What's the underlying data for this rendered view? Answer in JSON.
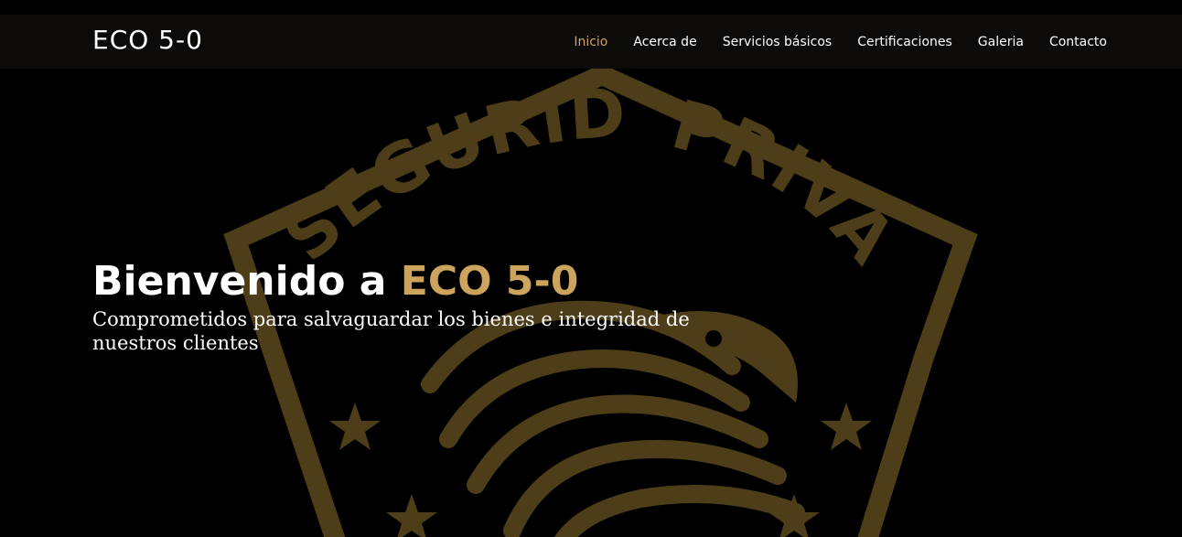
{
  "brand": {
    "name": "ECO 5-0"
  },
  "nav": {
    "items": [
      {
        "label": "Inicio",
        "active": true
      },
      {
        "label": "Acerca de"
      },
      {
        "label": "Servicios básicos"
      },
      {
        "label": "Certificaciones"
      },
      {
        "label": "Galeria"
      },
      {
        "label": "Contacto"
      }
    ]
  },
  "hero": {
    "title_prefix": "Bienvenido a ",
    "title_accent": "ECO 5-0",
    "subtitle": "Comprometidos para salvaguardar los bienes e integridad de nuestros clientes",
    "badge": {
      "text_top_left": "SEGURIDAD",
      "text_top_right": "PRIVADA"
    }
  },
  "colors": {
    "accent": "#cda45e",
    "background": "#000000",
    "badge_gold": "#5e4c1f",
    "navbar_bg": "#0c0b09"
  }
}
